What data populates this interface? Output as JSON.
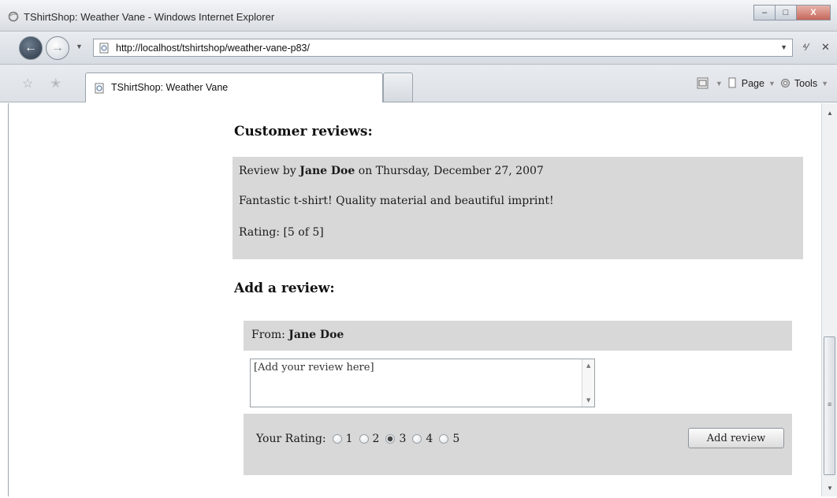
{
  "window": {
    "title": "TShirtShop: Weather Vane - Windows Internet Explorer",
    "minimize_glyph": "–",
    "maximize_glyph": "□",
    "close_glyph": "X"
  },
  "address_bar": {
    "url": "http://localhost/tshirtshop/weather-vane-p83/",
    "refresh_glyph": "⁴⁄",
    "stop_glyph": "✕"
  },
  "tabs": [
    {
      "label": "TShirtShop: Weather Vane"
    }
  ],
  "command_bar": {
    "page_label": "Page",
    "tools_label": "Tools"
  },
  "reviews": {
    "heading": "Customer reviews:",
    "items": [
      {
        "prefix": "Review by ",
        "author": "Jane Doe",
        "date_text": " on Thursday, December 27, 2007",
        "text": "Fantastic t-shirt! Quality material and beautiful imprint!",
        "rating_text": "Rating: [5 of 5]"
      }
    ]
  },
  "add_review": {
    "heading": "Add a review:",
    "from_label": "From: ",
    "from_name": "Jane Doe",
    "textarea_value": "[Add your review here]",
    "rating_label": "Your Rating:",
    "rating_options": [
      "1",
      "2",
      "3",
      "4",
      "5"
    ],
    "selected_rating": "3",
    "submit_label": "Add review"
  },
  "icons": {
    "app": "ie-icon",
    "back": "back-arrow-icon",
    "forward": "forward-arrow-icon",
    "page": "page-icon",
    "favorites": "star-icon",
    "add_favorites": "add-favorite-icon",
    "feeds": "feed-icon",
    "print": "print-icon",
    "tools": "gear-icon"
  }
}
